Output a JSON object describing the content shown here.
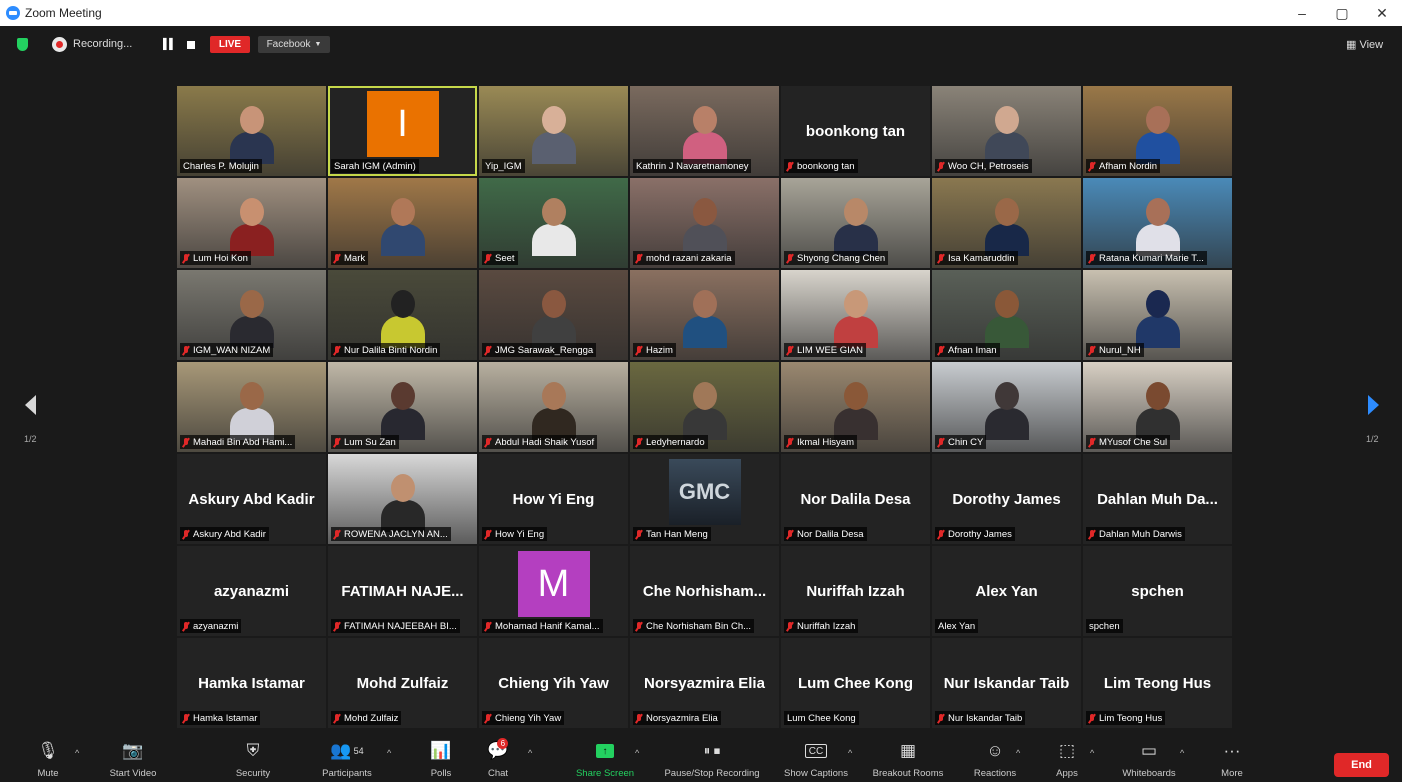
{
  "window": {
    "title": "Zoom Meeting",
    "minimize": "–",
    "restore": "▢",
    "close": "✕"
  },
  "topbar": {
    "recording_label": "Recording...",
    "live_label": "LIVE",
    "stream_target": "Facebook",
    "view_label": "View"
  },
  "pagination": {
    "left": "1/2",
    "right": "1/2"
  },
  "colors": {
    "accent": "#2d8cff",
    "end": "#e02828",
    "live": "#e02828",
    "share": "#23d160",
    "active_speaker": "#c6d84a"
  },
  "tiles": [
    {
      "label": "Charles P. Molujin",
      "muted": false,
      "kind": "video",
      "bg": "#8a7a4a",
      "skin": "#c89478",
      "shirt": "#2a3550"
    },
    {
      "label": "Sarah IGM (Admin)",
      "muted": false,
      "kind": "avatar",
      "avatar_letter": "I",
      "avatar_color": "#ea7200",
      "active": true
    },
    {
      "label": "Yip_IGM",
      "muted": false,
      "kind": "video",
      "bg": "#9a8a55",
      "skin": "#d8b098",
      "shirt": "#5a6070"
    },
    {
      "label": "Kathrin J Navaretnamoney",
      "muted": false,
      "kind": "video",
      "bg": "#7a6a5e",
      "skin": "#b88068",
      "shirt": "#d06080"
    },
    {
      "label": "boonkong tan",
      "muted": true,
      "kind": "name",
      "big_name": "boonkong tan"
    },
    {
      "label": "Woo CH, Petroseis",
      "muted": true,
      "kind": "video",
      "bg": "#8a8378",
      "skin": "#d0a890",
      "shirt": "#404858"
    },
    {
      "label": "Afham Nordin",
      "muted": true,
      "kind": "video",
      "bg": "#9a7848",
      "skin": "#a87058",
      "shirt": "#2050a0"
    },
    {
      "label": "Lum Hoi Kon",
      "muted": true,
      "kind": "video",
      "bg": "#a09080",
      "skin": "#c89070",
      "shirt": "#8a2020"
    },
    {
      "label": "Mark",
      "muted": true,
      "kind": "video",
      "bg": "#a07848",
      "skin": "#b07858",
      "shirt": "#304870"
    },
    {
      "label": "Seet",
      "muted": true,
      "kind": "video",
      "bg": "#406a48",
      "skin": "#b08060",
      "shirt": "#e8e8e8"
    },
    {
      "label": "mohd razani zakaria",
      "muted": true,
      "kind": "video",
      "bg": "#8a7068",
      "skin": "#8a5840",
      "shirt": "#505058"
    },
    {
      "label": "Shyong Chang Chen",
      "muted": true,
      "kind": "video",
      "bg": "#a8a498",
      "skin": "#b88868",
      "shirt": "#283048"
    },
    {
      "label": "Isa Kamaruddin",
      "muted": true,
      "kind": "video",
      "bg": "#8a7850",
      "skin": "#9a6848",
      "shirt": "#182848"
    },
    {
      "label": "Ratana Kumari Marie T...",
      "muted": true,
      "kind": "video",
      "bg": "#4a8ab8",
      "skin": "#a87058",
      "shirt": "#e0e0e8"
    },
    {
      "label": "IGM_WAN NIZAM",
      "muted": true,
      "kind": "video",
      "bg": "#7a7870",
      "skin": "#9a6848",
      "shirt": "#2a2a30"
    },
    {
      "label": "Nur Dalila Binti Nordin",
      "muted": true,
      "kind": "video",
      "bg": "#4a4a3a",
      "skin": "#222222",
      "shirt": "#c8c830"
    },
    {
      "label": "JMG Sarawak_Rengga",
      "muted": true,
      "kind": "video",
      "bg": "#5a4a40",
      "skin": "#8a5840",
      "shirt": "#404040"
    },
    {
      "label": "Hazim",
      "muted": true,
      "kind": "video",
      "bg": "#8a7060",
      "skin": "#a07058",
      "shirt": "#205080"
    },
    {
      "label": "LIM WEE GIAN",
      "muted": true,
      "kind": "video",
      "bg": "#d8d4cc",
      "skin": "#c89878",
      "shirt": "#c04040"
    },
    {
      "label": "Afnan Iman",
      "muted": true,
      "kind": "video",
      "bg": "#5a6058",
      "skin": "#8a5838",
      "shirt": "#385838"
    },
    {
      "label": "Nurul_NH",
      "muted": true,
      "kind": "video",
      "bg": "#c8c0b0",
      "skin": "#1a2850",
      "shirt": "#203868"
    },
    {
      "label": "Mahadi Bin Abd Hami...",
      "muted": true,
      "kind": "video",
      "bg": "#a89878",
      "skin": "#9a6848",
      "shirt": "#d0d0d8"
    },
    {
      "label": "Lum Su Zan",
      "muted": true,
      "kind": "video",
      "bg": "#c0b8a8",
      "skin": "#5a3a30",
      "shirt": "#282830"
    },
    {
      "label": "Abdul Hadi Shaik Yusof",
      "muted": true,
      "kind": "video",
      "bg": "#b8b0a0",
      "skin": "#a87858",
      "shirt": "#302820"
    },
    {
      "label": "Ledyhernardo",
      "muted": true,
      "kind": "video",
      "bg": "#6a6840",
      "skin": "#a07858",
      "shirt": "#383838"
    },
    {
      "label": "Ikmal Hisyam",
      "muted": true,
      "kind": "video",
      "bg": "#9a8870",
      "skin": "#8a5838",
      "shirt": "#383030"
    },
    {
      "label": "Chin CY",
      "muted": true,
      "kind": "video",
      "bg": "#c8ccd0",
      "skin": "#403838",
      "shirt": "#2a2a30"
    },
    {
      "label": "MYusof Che Sul",
      "muted": true,
      "kind": "video",
      "bg": "#d8d0c4",
      "skin": "#7a4a30",
      "shirt": "#303030"
    },
    {
      "label": "Askury Abd Kadir",
      "muted": true,
      "kind": "name",
      "big_name": "Askury Abd Kadir"
    },
    {
      "label": "ROWENA JACLYN AN...",
      "muted": true,
      "kind": "video",
      "bg": "#d8d8d8",
      "skin": "#c09070",
      "shirt": "#282828"
    },
    {
      "label": "How Yi Eng",
      "muted": true,
      "kind": "name",
      "big_name": "How Yi Eng"
    },
    {
      "label": "Tan Han Meng",
      "muted": true,
      "kind": "logo",
      "logo_text": "GMC"
    },
    {
      "label": "Nor Dalila Desa",
      "muted": true,
      "kind": "name",
      "big_name": "Nor Dalila Desa"
    },
    {
      "label": "Dorothy James",
      "muted": true,
      "kind": "name",
      "big_name": "Dorothy James"
    },
    {
      "label": "Dahlan Muh Darwis",
      "muted": true,
      "kind": "name",
      "big_name": "Dahlan Muh Da..."
    },
    {
      "label": "azyanazmi",
      "muted": true,
      "kind": "name",
      "big_name": "azyanazmi"
    },
    {
      "label": "FATIMAH NAJEEBAH BI...",
      "muted": true,
      "kind": "name",
      "big_name": "FATIMAH NAJE..."
    },
    {
      "label": "Mohamad Hanif Kamal...",
      "muted": true,
      "kind": "avatar",
      "avatar_letter": "M",
      "avatar_color": "#b43fc0"
    },
    {
      "label": "Che Norhisham Bin Ch...",
      "muted": true,
      "kind": "name",
      "big_name": "Che Norhisham..."
    },
    {
      "label": "Nuriffah Izzah",
      "muted": true,
      "kind": "name",
      "big_name": "Nuriffah Izzah"
    },
    {
      "label": "Alex Yan",
      "muted": false,
      "kind": "name",
      "big_name": "Alex Yan"
    },
    {
      "label": "spchen",
      "muted": false,
      "kind": "name",
      "big_name": "spchen"
    },
    {
      "label": "Hamka Istamar",
      "muted": true,
      "kind": "name",
      "big_name": "Hamka Istamar"
    },
    {
      "label": "Mohd Zulfaiz",
      "muted": true,
      "kind": "name",
      "big_name": "Mohd Zulfaiz"
    },
    {
      "label": "Chieng Yih Yaw",
      "muted": true,
      "kind": "name",
      "big_name": "Chieng Yih Yaw"
    },
    {
      "label": "Norsyazmira Elia",
      "muted": true,
      "kind": "name",
      "big_name": "Norsyazmira Elia"
    },
    {
      "label": "Lum Chee Kong",
      "muted": false,
      "kind": "name",
      "big_name": "Lum Chee Kong"
    },
    {
      "label": "Nur Iskandar Taib",
      "muted": true,
      "kind": "name",
      "big_name": "Nur Iskandar Taib"
    },
    {
      "label": "Lim Teong Hus",
      "muted": true,
      "kind": "name",
      "big_name": "Lim Teong Hus"
    }
  ],
  "toolbar": {
    "mute": "Mute",
    "start_video": "Start Video",
    "security": "Security",
    "participants": "Participants",
    "participants_count": "54",
    "polls": "Polls",
    "chat": "Chat",
    "chat_badge": "6",
    "share_screen": "Share Screen",
    "pause_stop_recording": "Pause/Stop Recording",
    "show_captions": "Show Captions",
    "breakout_rooms": "Breakout Rooms",
    "reactions": "Reactions",
    "apps": "Apps",
    "whiteboards": "Whiteboards",
    "more": "More",
    "end": "End"
  }
}
